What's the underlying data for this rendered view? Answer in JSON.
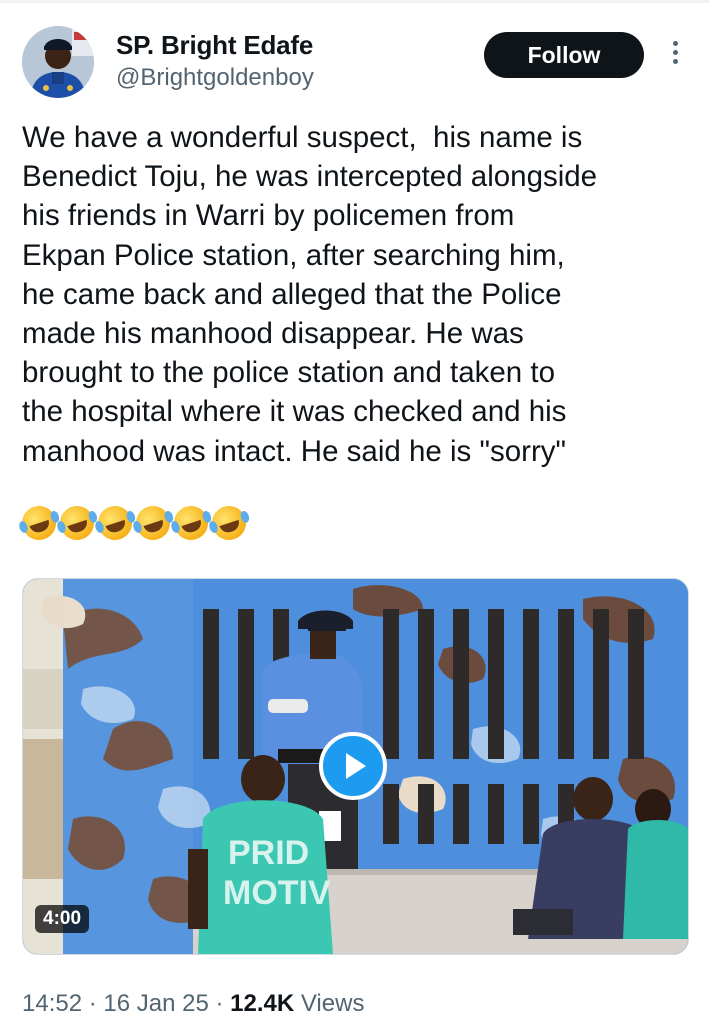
{
  "author": {
    "display_name": "SP. Bright Edafe",
    "handle": "@Brightgoldenboy",
    "avatar_icon": "police-officer-avatar"
  },
  "header": {
    "follow_label": "Follow",
    "more_icon": "vertical-ellipsis-icon"
  },
  "tweet": {
    "text": "We have a wonderful suspect,  his name is\nBenedict Toju, he was intercepted alongside\nhis friends in Warri by policemen from\nEkpan Police station, after searching him,\nhe came back and alleged that the Police\nmade his manhood disappear. He was\nbrought to the police station and taken to\nthe hospital where it was checked and his\nmanhood was intact. He said he is \"sorry\"",
    "emoji_count": 6,
    "emoji_name": "rolling-on-the-floor-laughing-emoji"
  },
  "media": {
    "type": "video",
    "duration": "4:00",
    "play_icon": "play-icon",
    "shirt_text_line1": "PRID",
    "shirt_text_line2": "MOTIV"
  },
  "meta": {
    "time": "14:52",
    "separator": " · ",
    "date": "16 Jan 25",
    "views_count": "12.4K",
    "views_label": " Views"
  },
  "colors": {
    "text": "#0f1419",
    "secondary": "#536471",
    "accent": "#1d9bf0",
    "follow_bg": "#0f1419"
  }
}
